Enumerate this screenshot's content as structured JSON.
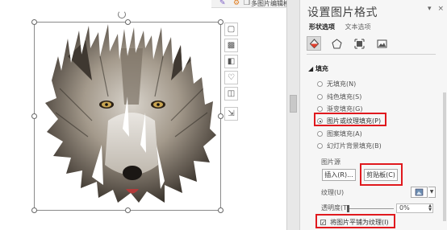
{
  "window": {
    "mini_toolbar_text": "多图片编辑模式"
  },
  "pane": {
    "title": "设置图片格式",
    "ctrl_dropdown": "▾",
    "ctrl_close": "×",
    "tabs": [
      {
        "label": "形状选项",
        "active": true
      },
      {
        "label": "文本选项",
        "active": false
      }
    ],
    "icons": [
      "fill-line-icon",
      "effects-icon",
      "size-properties-icon",
      "picture-icon"
    ],
    "fill_section": "◢ 填充",
    "fill_options": [
      {
        "label": "无填充(N)",
        "selected": false
      },
      {
        "label": "纯色填充(S)",
        "selected": false
      },
      {
        "label": "渐变填充(G)",
        "selected": false
      },
      {
        "label": "图片或纹理填充(P)",
        "selected": true
      },
      {
        "label": "图案填充(A)",
        "selected": false
      },
      {
        "label": "幻灯片背景填充(B)",
        "selected": false
      }
    ],
    "picture_source_label": "图片源",
    "insert_button": "插入(R)...",
    "clipboard_button": "剪贴板(C)",
    "texture_label": "纹理(U)",
    "transparency_label": "透明度(T)",
    "transparency_value": "0%",
    "transparency_level": 0,
    "tile_label": "将图片平铺为纹理(I)",
    "tile_checked": true,
    "tile_check_mark": "✓",
    "spin_up": "▲",
    "spin_down": "▼",
    "texture_dropdown": "▼"
  },
  "colors": {
    "highlight_box": "#e0191e",
    "pane_bg": "#f6f6f6"
  }
}
